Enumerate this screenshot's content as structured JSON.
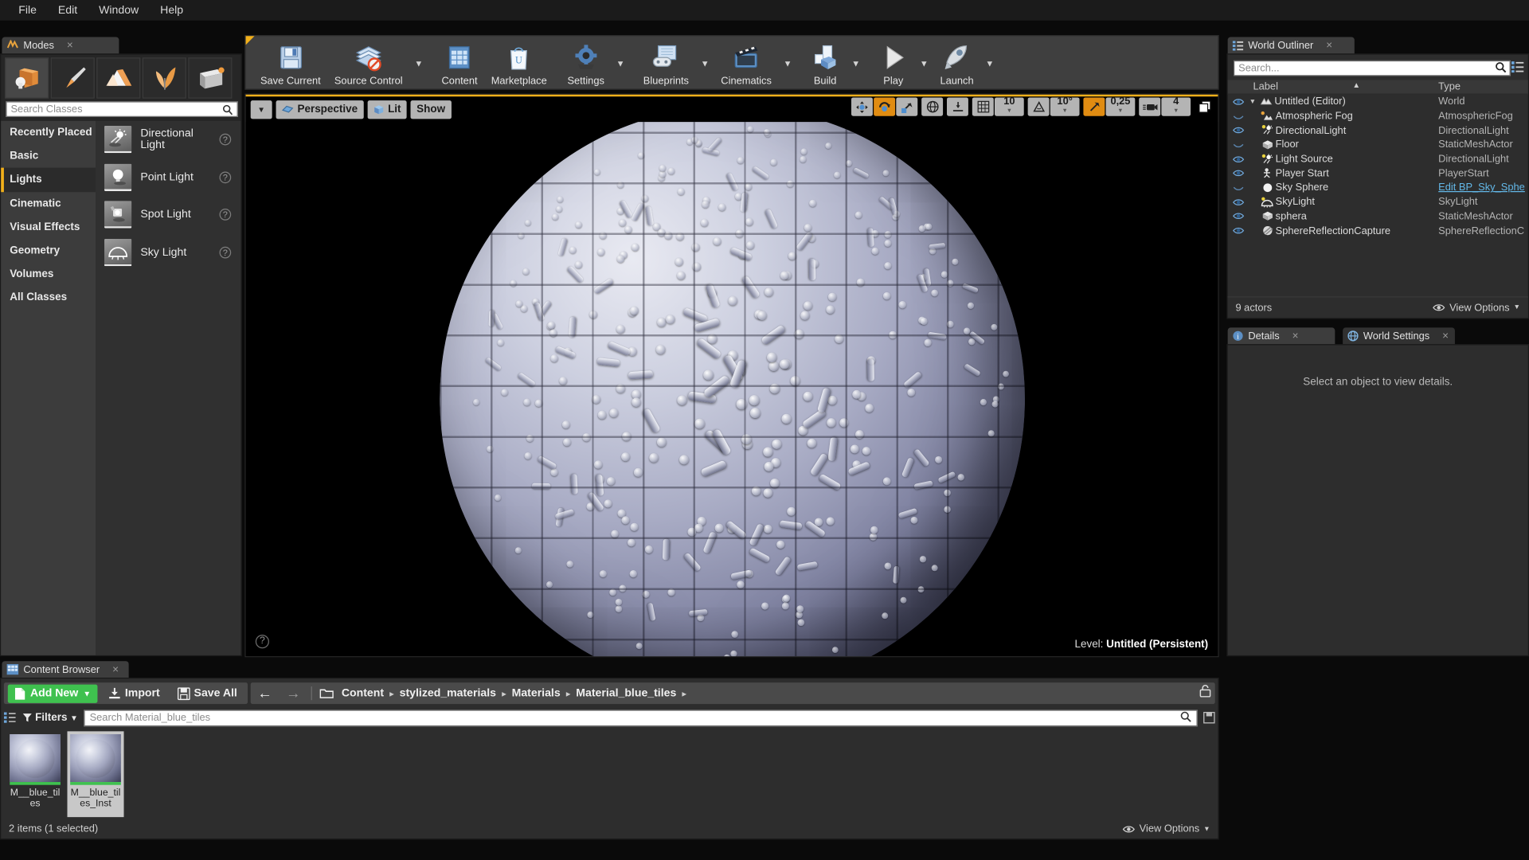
{
  "menubar": {
    "items": [
      "File",
      "Edit",
      "Window",
      "Help"
    ]
  },
  "modes": {
    "tab_title": "Modes",
    "tab_close": "×",
    "buttons": [
      {
        "name": "place-mode",
        "glyph": "📦"
      },
      {
        "name": "paint-mode",
        "glyph": "🖌"
      },
      {
        "name": "landscape-mode",
        "glyph": "⛰"
      },
      {
        "name": "foliage-mode",
        "glyph": "🌿"
      },
      {
        "name": "geometry-edit-mode",
        "glyph": "⬜"
      }
    ],
    "search_placeholder": "Search Classes",
    "categories": [
      "Recently Placed",
      "Basic",
      "Lights",
      "Cinematic",
      "Visual Effects",
      "Geometry",
      "Volumes",
      "All Classes"
    ],
    "selected_category": "Lights",
    "classes": [
      {
        "label": "Directional Light",
        "icon": "directional-light-icon",
        "help": "?"
      },
      {
        "label": "Point Light",
        "icon": "point-light-icon",
        "help": "?"
      },
      {
        "label": "Spot Light",
        "icon": "spot-light-icon",
        "help": "?"
      },
      {
        "label": "Sky Light",
        "icon": "sky-light-icon",
        "help": "?"
      }
    ]
  },
  "toolbar": {
    "buttons": [
      {
        "label": "Save Current",
        "icon": "floppy-disk-icon",
        "caret": false
      },
      {
        "label": "Source Control",
        "icon": "source-control-icon",
        "caret": true
      },
      {
        "label": "Content",
        "icon": "content-grid-icon",
        "caret": false
      },
      {
        "label": "Marketplace",
        "icon": "marketplace-bag-icon",
        "caret": false
      },
      {
        "label": "Settings",
        "icon": "gear-icon",
        "caret": true
      },
      {
        "label": "Blueprints",
        "icon": "blueprint-gamepad-icon",
        "caret": true
      },
      {
        "label": "Cinematics",
        "icon": "clapperboard-icon",
        "caret": true
      },
      {
        "label": "Build",
        "icon": "build-cubes-icon",
        "caret": true
      },
      {
        "label": "Play",
        "icon": "play-triangle-icon",
        "caret": true
      },
      {
        "label": "Launch",
        "icon": "launch-rocket-icon",
        "caret": true
      }
    ]
  },
  "viewport": {
    "menu_caret": "▼",
    "perspective_label": "Perspective",
    "lit_label": "Lit",
    "show_label": "Show",
    "transform_modes": [
      {
        "name": "select-translate-gizmo",
        "glyph": "✥",
        "active": false
      },
      {
        "name": "rotate-gizmo",
        "glyph": "⟳",
        "active": true
      },
      {
        "name": "scale-gizmo",
        "glyph": "⤡",
        "active": false
      }
    ],
    "coord_system": {
      "name": "world-coordinates-icon",
      "glyph": "🌐"
    },
    "surface_snap": {
      "name": "surface-snap-icon",
      "glyph": "⤴"
    },
    "grid_snap": {
      "name": "grid-snap-icon",
      "value": "10"
    },
    "angle_snap": {
      "name": "angle-snap-icon",
      "value": "10°"
    },
    "scale_snap": {
      "name": "scale-snap-icon",
      "value": "0,25",
      "active": true
    },
    "camera_speed": {
      "name": "camera-speed-icon",
      "value": "4"
    },
    "maximize": {
      "name": "maximize-viewport-icon",
      "glyph": "⧉"
    },
    "help": "?",
    "level_prefix": "Level:",
    "level_name": "Untitled (Persistent)"
  },
  "outliner": {
    "tab_title": "World Outliner",
    "tab_close": "×",
    "search_placeholder": "Search...",
    "columns": {
      "label": "Label",
      "type": "Type"
    },
    "rows": [
      {
        "label": "Untitled (Editor)",
        "type": "World",
        "visible": true,
        "indent": 0,
        "expander": "▼",
        "icon": "world-icon"
      },
      {
        "label": "Atmospheric Fog",
        "type": "AtmosphericFog",
        "visible": false,
        "indent": 1,
        "icon": "fog-icon"
      },
      {
        "label": "DirectionalLight",
        "type": "DirectionalLight",
        "visible": true,
        "indent": 1,
        "icon": "directional-light-icon"
      },
      {
        "label": "Floor",
        "type": "StaticMeshActor",
        "visible": false,
        "indent": 1,
        "icon": "static-mesh-icon"
      },
      {
        "label": "Light Source",
        "type": "DirectionalLight",
        "visible": true,
        "indent": 1,
        "icon": "directional-light-icon"
      },
      {
        "label": "Player Start",
        "type": "PlayerStart",
        "visible": true,
        "indent": 1,
        "icon": "player-start-icon"
      },
      {
        "label": "Sky Sphere",
        "type": "Edit BP_Sky_Sphe",
        "type_is_link": true,
        "visible": false,
        "indent": 1,
        "icon": "sphere-icon"
      },
      {
        "label": "SkyLight",
        "type": "SkyLight",
        "visible": true,
        "indent": 1,
        "icon": "sky-light-icon"
      },
      {
        "label": "sphera",
        "type": "StaticMeshActor",
        "visible": true,
        "indent": 1,
        "icon": "static-mesh-icon"
      },
      {
        "label": "SphereReflectionCapture",
        "type": "SphereReflectionC",
        "visible": true,
        "indent": 1,
        "icon": "reflection-capture-icon"
      }
    ],
    "actor_count": "9 actors",
    "view_options": "View Options"
  },
  "details": {
    "tabs": [
      {
        "label": "Details",
        "active": true,
        "close": "×",
        "icon": "details-icon"
      },
      {
        "label": "World Settings",
        "active": false,
        "close": "×",
        "icon": "world-settings-icon"
      }
    ],
    "empty_message": "Select an object to view details."
  },
  "content_browser": {
    "tab_title": "Content Browser",
    "tab_close": "×",
    "add_new_label": "Add New",
    "add_new_caret": "▾",
    "import_label": "Import",
    "save_all_label": "Save All",
    "nav_back": "←",
    "nav_forward": "→",
    "breadcrumbs": [
      "Content",
      "stylized_materials",
      "Materials",
      "Material_blue_tiles"
    ],
    "breadcrumb_sep": "▸",
    "filters_label": "Filters",
    "filters_caret": "▾",
    "search_placeholder": "Search Material_blue_tiles",
    "assets": [
      {
        "name": "M__blue_tiles",
        "selected": false
      },
      {
        "name": "M__blue_tiles_Inst",
        "selected": true
      }
    ],
    "status": "2 items (1 selected)",
    "view_options": "View Options"
  },
  "colors": {
    "accent_yellow": "#f2b01a",
    "accent_orange": "#e08c12",
    "green": "#3fc14f",
    "link_blue": "#63b8e8"
  }
}
